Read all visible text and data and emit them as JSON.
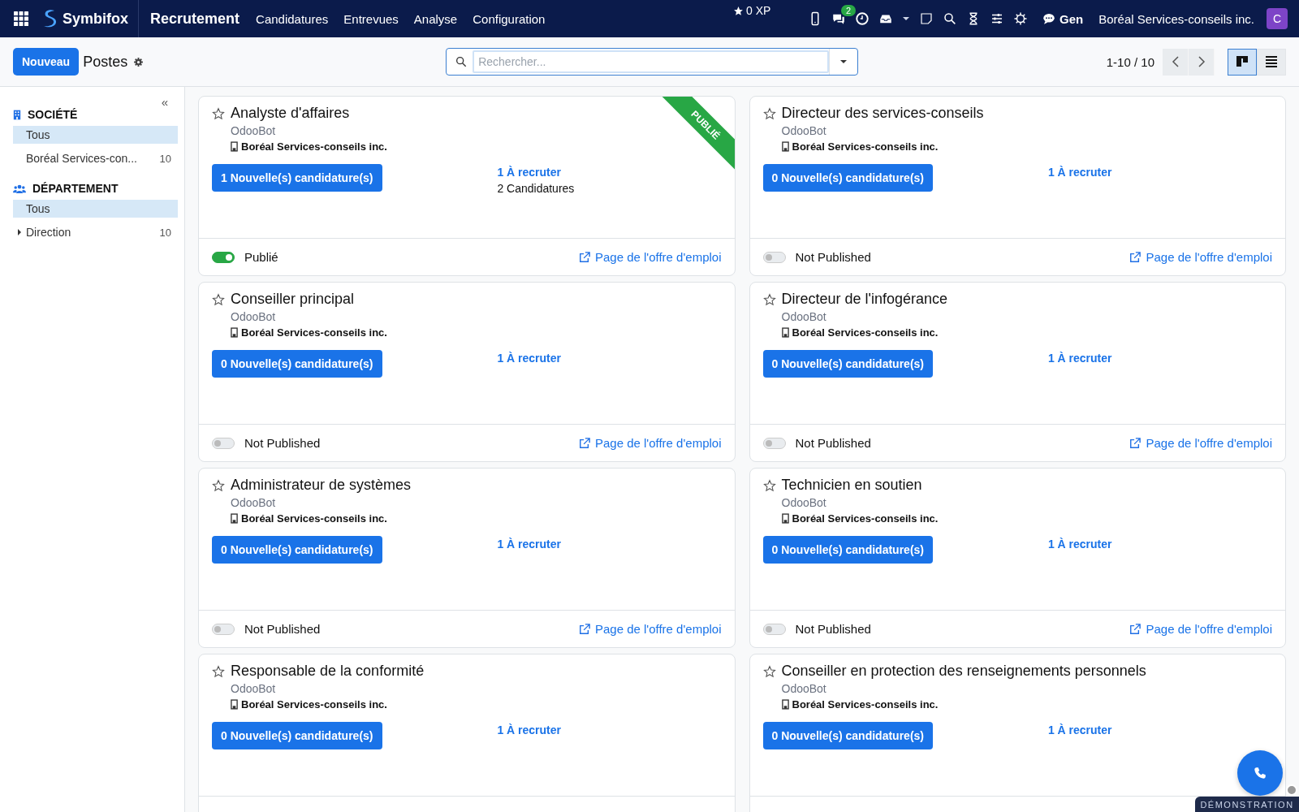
{
  "navbar": {
    "brand": "Symbifox",
    "app": "Recrutement",
    "menu": [
      "Candidatures",
      "Entrevues",
      "Analyse",
      "Configuration"
    ],
    "xp": "0 XP",
    "chat_badge": "2",
    "chat_label": "Gen",
    "company": "Boréal Services-conseils inc.",
    "avatar": "C"
  },
  "control_bar": {
    "new_button": "Nouveau",
    "title": "Postes",
    "search": {
      "placeholder": "Rechercher..."
    },
    "pager": "1-10 / 10",
    "views": [
      {
        "kind": "kanban",
        "selected": true
      },
      {
        "kind": "list",
        "selected": false
      }
    ]
  },
  "sidebar": {
    "collapse": "«",
    "sections": [
      {
        "kind": "company",
        "title": "SOCIÉTÉ",
        "items": [
          {
            "label": "Tous",
            "selected": true
          },
          {
            "label": "Boréal Services-con...",
            "count": "10",
            "selected": false
          }
        ]
      },
      {
        "kind": "department",
        "title": "DÉPARTEMENT",
        "items": [
          {
            "label": "Tous",
            "selected": true
          },
          {
            "label": "Direction",
            "count": "10",
            "selected": false,
            "expanded": false
          }
        ]
      }
    ]
  },
  "cards": [
    {
      "title": "Analyste d'affaires",
      "owner": "OdooBot",
      "company": "Boréal Services-conseils inc.",
      "favorite": false,
      "ribbon": "PUBLIÉ",
      "new_button": "1 Nouvelle(s) candidature(s)",
      "to_recruit": "1 À recruter",
      "applications": "2 Candidatures",
      "published": true,
      "status": "Publié",
      "link": "Page de l'offre d'emploi"
    },
    {
      "title": "Directeur des services-conseils",
      "owner": "OdooBot",
      "company": "Boréal Services-conseils inc.",
      "favorite": false,
      "new_button": "0 Nouvelle(s) candidature(s)",
      "to_recruit": "1 À recruter",
      "published": false,
      "status": "Not Published",
      "link": "Page de l'offre d'emploi"
    },
    {
      "title": "Conseiller principal",
      "owner": "OdooBot",
      "company": "Boréal Services-conseils inc.",
      "favorite": false,
      "new_button": "0 Nouvelle(s) candidature(s)",
      "to_recruit": "1 À recruter",
      "published": false,
      "status": "Not Published",
      "link": "Page de l'offre d'emploi"
    },
    {
      "title": "Directeur de l'infogérance",
      "owner": "OdooBot",
      "company": "Boréal Services-conseils inc.",
      "favorite": false,
      "new_button": "0 Nouvelle(s) candidature(s)",
      "to_recruit": "1 À recruter",
      "published": false,
      "status": "Not Published",
      "link": "Page de l'offre d'emploi"
    },
    {
      "title": "Administrateur de systèmes",
      "owner": "OdooBot",
      "company": "Boréal Services-conseils inc.",
      "favorite": false,
      "new_button": "0 Nouvelle(s) candidature(s)",
      "to_recruit": "1 À recruter",
      "published": false,
      "status": "Not Published",
      "link": "Page de l'offre d'emploi"
    },
    {
      "title": "Technicien en soutien",
      "owner": "OdooBot",
      "company": "Boréal Services-conseils inc.",
      "favorite": false,
      "new_button": "0 Nouvelle(s) candidature(s)",
      "to_recruit": "1 À recruter",
      "published": false,
      "status": "Not Published",
      "link": "Page de l'offre d'emploi"
    },
    {
      "title": "Responsable de la conformité",
      "owner": "OdooBot",
      "company": "Boréal Services-conseils inc.",
      "favorite": false,
      "new_button": "0 Nouvelle(s) candidature(s)",
      "to_recruit": "1 À recruter"
    },
    {
      "title": "Conseiller en protection des renseignements personnels",
      "owner": "OdooBot",
      "company": "Boréal Services-conseils inc.",
      "favorite": false,
      "new_button": "0 Nouvelle(s) candidature(s)",
      "to_recruit": "1 À recruter"
    }
  ],
  "demo_badge": "DÉMONSTRATION"
}
